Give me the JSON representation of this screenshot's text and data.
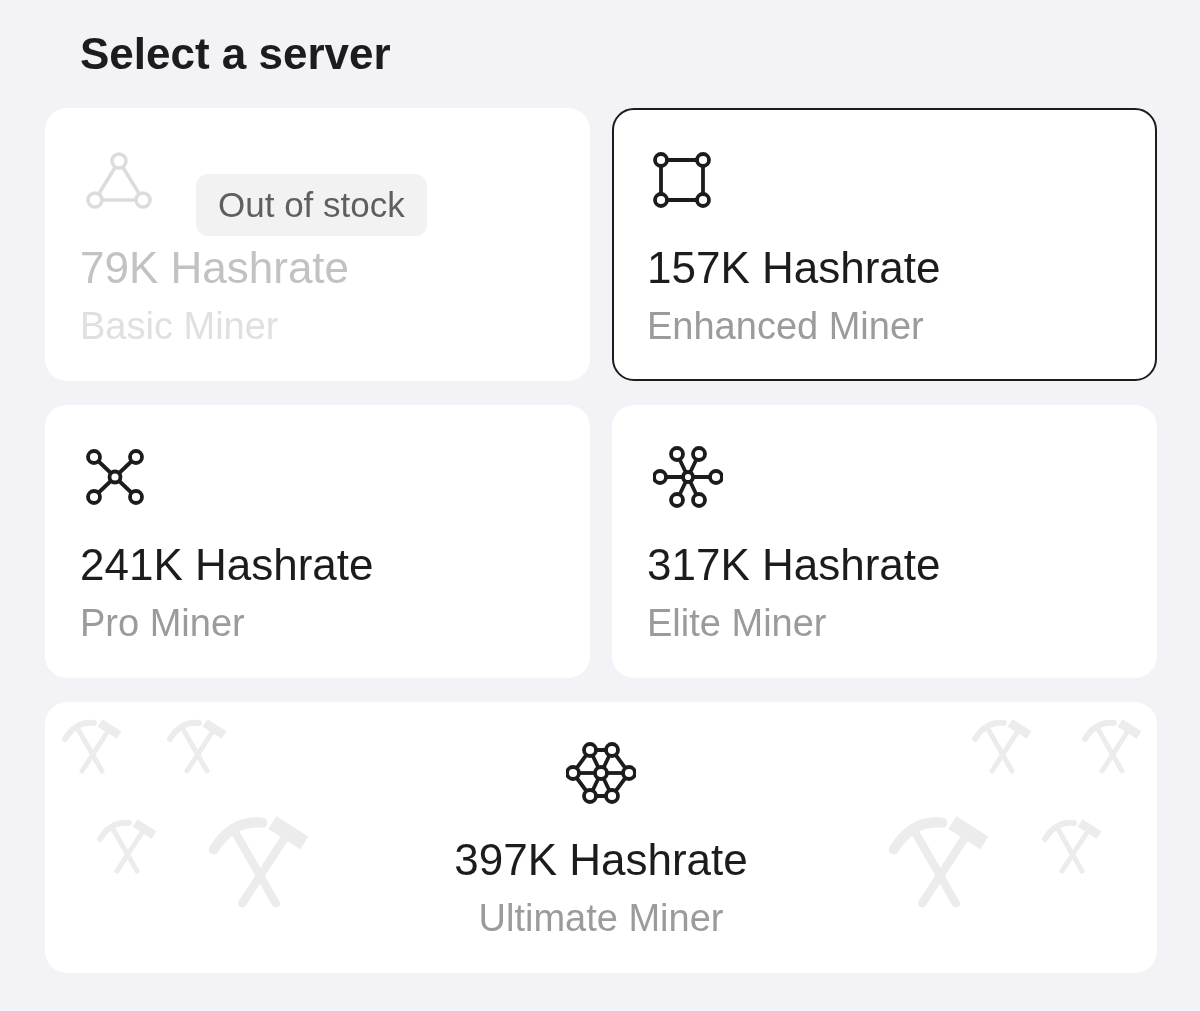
{
  "title": "Select a server",
  "servers": [
    {
      "kind": "tile",
      "hashrate": "79K Hashrate",
      "tier": "Basic Miner",
      "disabled": true,
      "selected": false,
      "badge": "Out of stock"
    },
    {
      "kind": "tile",
      "hashrate": "157K Hashrate",
      "tier": "Enhanced Miner",
      "disabled": false,
      "selected": true
    },
    {
      "kind": "tile",
      "hashrate": "241K Hashrate",
      "tier": "Pro Miner",
      "disabled": false,
      "selected": false
    },
    {
      "kind": "tile",
      "hashrate": "317K Hashrate",
      "tier": "Elite Miner",
      "disabled": false,
      "selected": false
    },
    {
      "kind": "wide",
      "hashrate": "397K Hashrate",
      "tier": "Ultimate Miner",
      "disabled": false,
      "selected": false
    }
  ]
}
